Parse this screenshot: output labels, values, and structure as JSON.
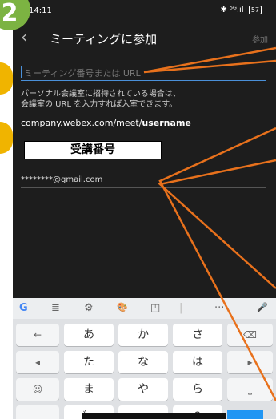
{
  "status": {
    "time": "14:11",
    "signal": "✱ ⁵ᴳ.ıl",
    "battery": "57"
  },
  "header": {
    "back": "‹",
    "title": "ミーティングに参加",
    "join": "参加"
  },
  "form": {
    "meeting_placeholder": "ミーティング番号または URL",
    "note_line1": "パーソナル会議室に招待されている場合は、",
    "note_line2": "会議室の URL を入力すれば入室できます。",
    "url_prefix": "company.webex.com/meet/",
    "url_user": "username",
    "email": "********@gmail.com"
  },
  "annotations": {
    "step": "2",
    "label": "受講番号"
  },
  "keyboard": {
    "toolbar": [
      "G",
      "≣",
      "⚙",
      "🎨",
      "◳",
      "|",
      "···",
      "🎤"
    ],
    "rows": [
      [
        "←",
        "あ",
        "か",
        "さ",
        "⌫"
      ],
      [
        "◂",
        "た",
        "な",
        "は",
        "▸"
      ],
      [
        "☺",
        "ま",
        "や",
        "ら",
        "⎵"
      ],
      [
        "",
        "゛",
        "",
        "?",
        ""
      ]
    ]
  },
  "colors": {
    "accent": "#4a90d9",
    "callout": "#e8711c",
    "badge_orange": "#f0b400",
    "badge_green": "#7cb342"
  }
}
